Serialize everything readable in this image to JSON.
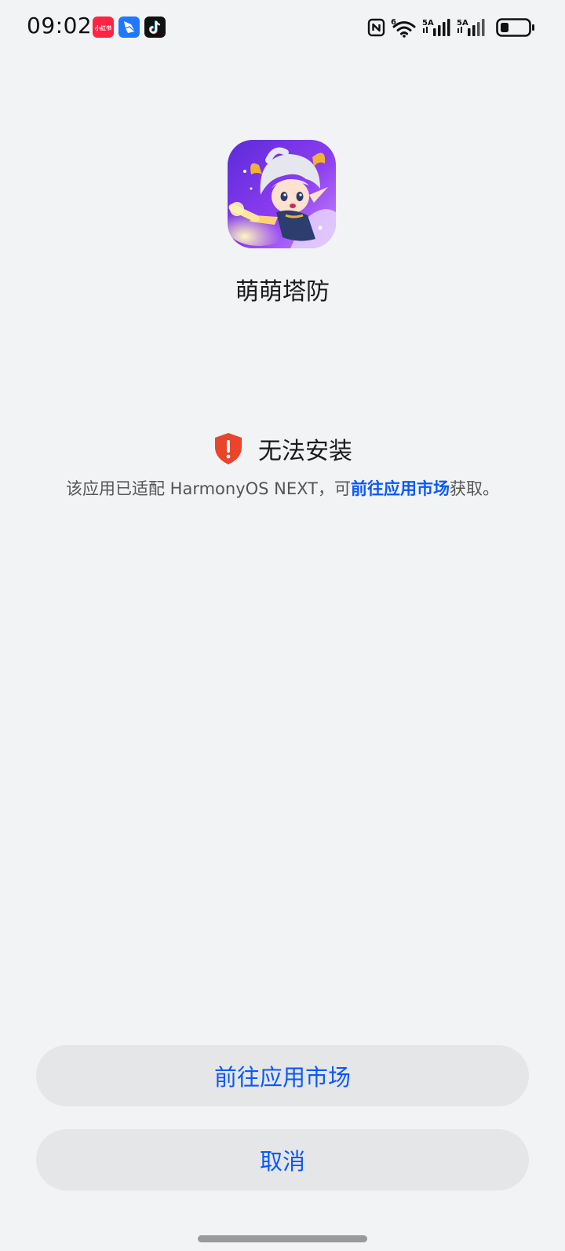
{
  "status_bar": {
    "time": "09:02",
    "notification_icons": [
      "xiaohongshu-app-icon",
      "feishu-app-icon",
      "tiktok-app-icon"
    ],
    "xiaohongshu_label": "小红书",
    "wifi_badge": "6",
    "sim1_label": "5A",
    "sim2_label": "5A",
    "system_icons": [
      "nfc-icon",
      "wifi-icon",
      "signal-sim1-icon",
      "signal-sim2-icon",
      "battery-icon"
    ]
  },
  "app": {
    "name": "萌萌塔防",
    "icon": "game-character-icon"
  },
  "warning": {
    "title": "无法安装",
    "desc_prefix": "该应用已适配 HarmonyOS NEXT，可",
    "desc_link": "前往应用市场",
    "desc_suffix": "获取。",
    "icon": "shield-alert-icon",
    "icon_color": "#e8452c"
  },
  "buttons": {
    "market_label": "前往应用市场",
    "cancel_label": "取消"
  },
  "colors": {
    "background": "#f1f3f5",
    "accent": "#0a59f7",
    "button_bg": "#e5e6e8"
  }
}
